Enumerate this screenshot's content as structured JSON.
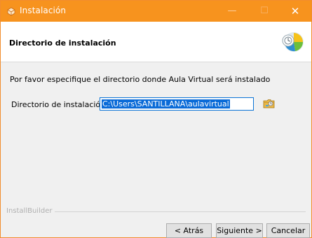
{
  "window": {
    "title": "Instalación",
    "controls": {
      "minimize": "—",
      "maximize": "☐",
      "close": "✕"
    }
  },
  "header": {
    "heading": "Directorio de instalación"
  },
  "body": {
    "instructions": "Por favor especifique el directorio donde Aula Virtual será instalado",
    "directory_label": "Directorio de instalación",
    "directory_value": "C:\\Users\\SANTILLANA\\aulavirtual"
  },
  "footer": {
    "brand": "InstallBuilder",
    "back_label": "< Atrás",
    "next_label": "Siguiente >",
    "cancel_label": "Cancelar"
  },
  "colors": {
    "titlebar": "#f7931e",
    "selection": "#0a6bd8"
  },
  "icons": {
    "app": "installer-app-icon",
    "logo": "installbuilder-logo-icon",
    "browse": "folder-browse-icon"
  }
}
